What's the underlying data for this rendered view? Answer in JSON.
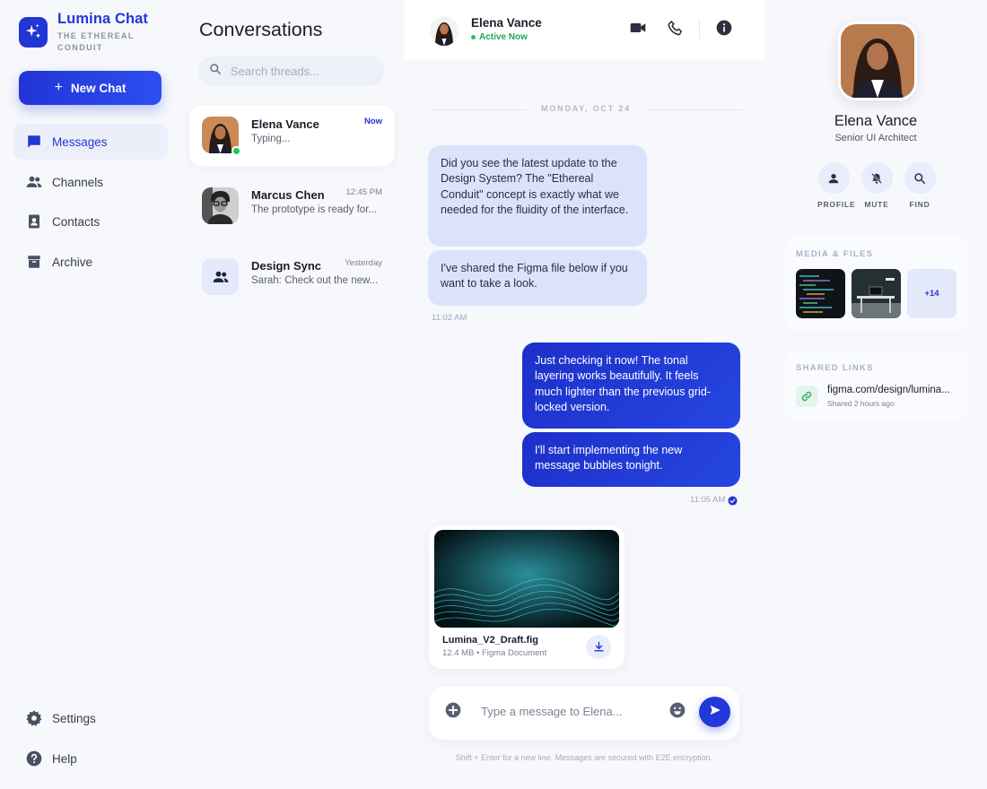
{
  "app": {
    "name": "Lumina Chat",
    "tagline": "THE ETHEREAL CONDUIT",
    "new_chat_label": "New Chat"
  },
  "nav": {
    "items": [
      {
        "label": "Messages",
        "icon": "message-icon",
        "active": true
      },
      {
        "label": "Channels",
        "icon": "people-icon"
      },
      {
        "label": "Contacts",
        "icon": "contact-card-icon"
      },
      {
        "label": "Archive",
        "icon": "archive-icon"
      }
    ],
    "footer": [
      {
        "label": "Settings",
        "icon": "gear-icon"
      },
      {
        "label": "Help",
        "icon": "help-icon"
      }
    ]
  },
  "conversations": {
    "title": "Conversations",
    "search_placeholder": "Search threads...",
    "threads": [
      {
        "name": "Elena Vance",
        "time": "Now",
        "preview": "Typing...",
        "online": true,
        "active": true
      },
      {
        "name": "Marcus Chen",
        "time": "12:45 PM",
        "preview": "The prototype is ready for..."
      },
      {
        "name": "Design Sync",
        "time": "Yesterday",
        "preview": "Sarah: Check out the new..."
      }
    ]
  },
  "chat": {
    "contact_name": "Elena Vance",
    "status": "Active Now",
    "day_label": "MONDAY, OCT 24",
    "messages": [
      {
        "from": "them",
        "text": "Did you see the latest update to the Design System? The \"Ethereal Conduit\" concept is exactly what we needed for the fluidity of the interface."
      },
      {
        "from": "them",
        "text": "I've shared the Figma file below if you want to take a look."
      },
      {
        "from": "me",
        "text": "Just checking it now! The tonal layering works beautifully. It feels much lighter than the previous grid-locked version."
      },
      {
        "from": "me",
        "text": "I'll start implementing the new message bubbles tonight."
      }
    ],
    "time_in": "11:02 AM",
    "time_out": "11:05 AM",
    "attachment": {
      "name": "Lumina_V2_Draft.fig",
      "meta": "12.4 MB • Figma Document"
    },
    "composer_placeholder": "Type a message to Elena...",
    "hint": "Shift + Enter for a new line. Messages are secured with E2E encryption."
  },
  "profile": {
    "name": "Elena Vance",
    "role": "Senior UI Architect",
    "actions": [
      "PROFILE",
      "MUTE",
      "FIND"
    ],
    "media_title": "MEDIA & FILES",
    "media_more": "+14",
    "links_title": "SHARED LINKS",
    "link_url": "figma.com/design/lumina...",
    "link_when": "Shared 2 hours ago"
  },
  "colors": {
    "accent": "#2236d6",
    "bubble_in": "#dbe3fb",
    "online": "#22c55e"
  }
}
